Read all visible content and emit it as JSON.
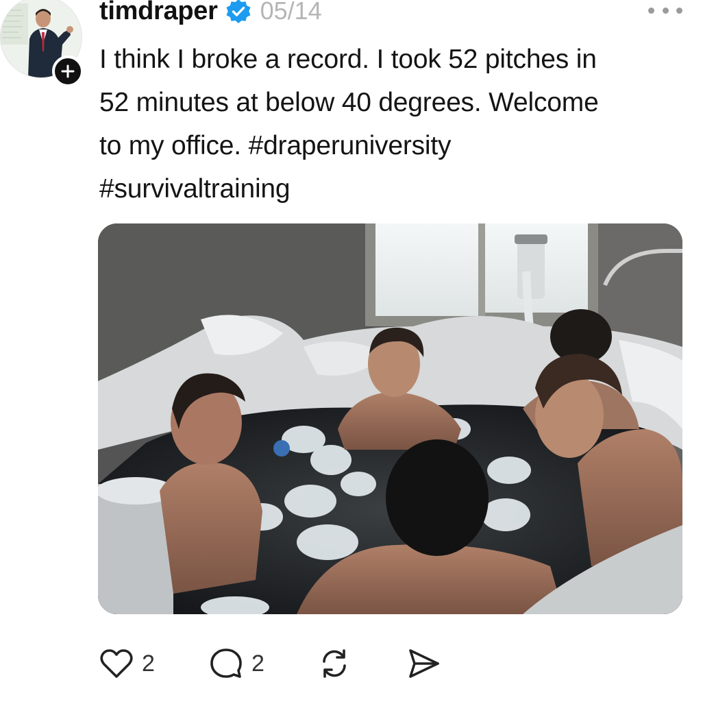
{
  "colors": {
    "verified_badge": "#1d9bf0",
    "text": "#141414",
    "muted": "#b5b5b5",
    "icon": "#222222"
  },
  "post": {
    "author": {
      "username": "timdraper",
      "verified": true,
      "avatar_icon": "avatar-photo",
      "follow_icon": "plus-icon"
    },
    "date": "05/14",
    "more_icon": "more-dots-icon",
    "text_lines": [
      "I think I broke a record. I took 52 pitches in",
      "52 minutes at below 40 degrees. Welcome",
      "to my office. #draperuniversity",
      "#survivaltraining"
    ],
    "hashtags": [
      "#draperuniversity",
      "#survivaltraining"
    ],
    "media_icon": "photo-ice-bath"
  },
  "actions": {
    "like": {
      "icon": "heart-icon",
      "count": "2"
    },
    "reply": {
      "icon": "comment-icon",
      "count": "2"
    },
    "repost": {
      "icon": "repost-icon"
    },
    "share": {
      "icon": "send-icon"
    }
  }
}
